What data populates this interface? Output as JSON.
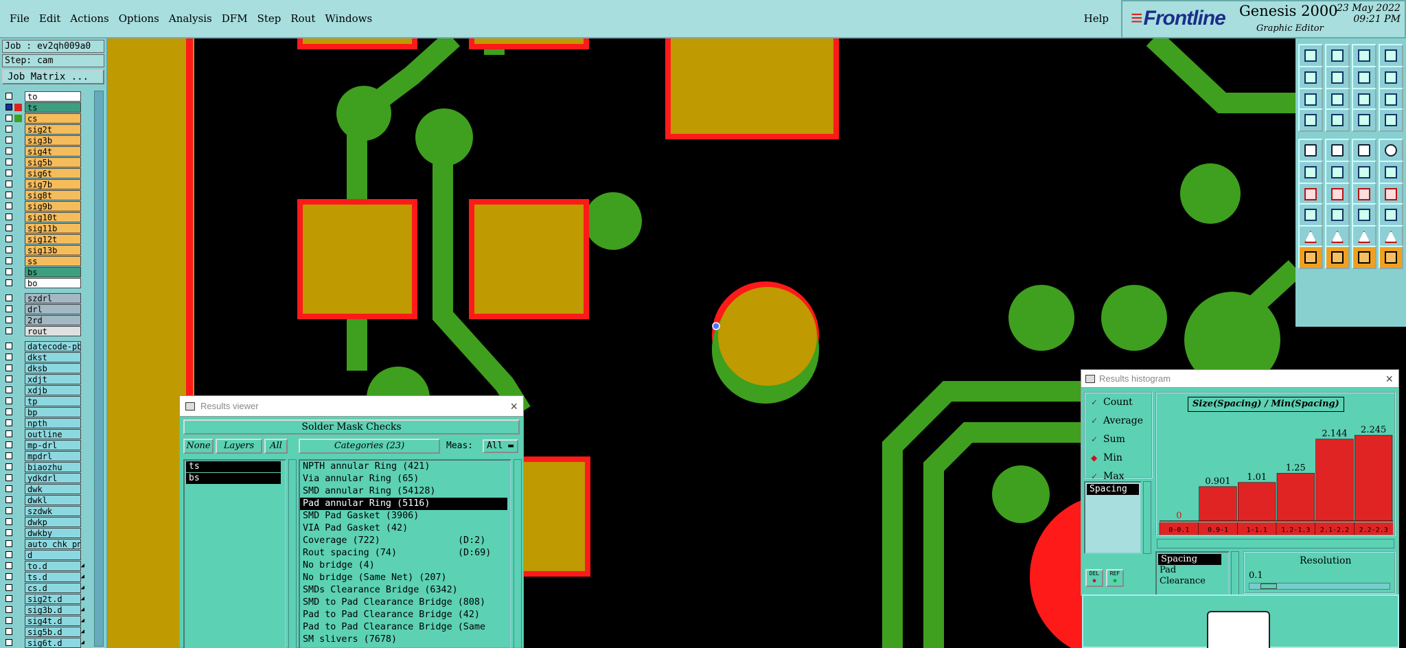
{
  "menu": [
    "File",
    "Edit",
    "Actions",
    "Options",
    "Analysis",
    "DFM",
    "Step",
    "Rout",
    "Windows"
  ],
  "help": "Help",
  "brand": {
    "logo": "Frontline",
    "product": "Genesis 2000",
    "subtitle": "Graphic Editor",
    "date": "23 May 2022",
    "time": "09:21 PM"
  },
  "job": {
    "job_line": "Job : ev2qh009a0",
    "step_line": "Step: cam",
    "matrix_button": "Job Matrix ..."
  },
  "layers": [
    {
      "name": "to",
      "bg": "#ffffff",
      "swatch": ""
    },
    {
      "name": "ts",
      "bg": "#3ca080",
      "swatch": "#e02020",
      "active": true
    },
    {
      "name": "cs",
      "bg": "#f5bc5c",
      "swatch": "#3f9f1f"
    },
    {
      "name": "sig2t",
      "bg": "#f5bc5c"
    },
    {
      "name": "sig3b",
      "bg": "#f5bc5c"
    },
    {
      "name": "sig4t",
      "bg": "#f5bc5c"
    },
    {
      "name": "sig5b",
      "bg": "#f5bc5c"
    },
    {
      "name": "sig6t",
      "bg": "#f5bc5c"
    },
    {
      "name": "sig7b",
      "bg": "#f5bc5c"
    },
    {
      "name": "sig8t",
      "bg": "#f5bc5c"
    },
    {
      "name": "sig9b",
      "bg": "#f5bc5c"
    },
    {
      "name": "sig10t",
      "bg": "#f5bc5c"
    },
    {
      "name": "sig11b",
      "bg": "#f5bc5c"
    },
    {
      "name": "sig12t",
      "bg": "#f5bc5c"
    },
    {
      "name": "sig13b",
      "bg": "#f5bc5c"
    },
    {
      "name": "ss",
      "bg": "#f5bc5c"
    },
    {
      "name": "bs",
      "bg": "#3ca080"
    },
    {
      "name": "bo",
      "bg": "#ffffff"
    },
    {
      "gap": true
    },
    {
      "name": "szdrl",
      "bg": "#a4b8c4"
    },
    {
      "name": "drl",
      "bg": "#a4b8c4"
    },
    {
      "name": "2rd",
      "bg": "#a4b8c4"
    },
    {
      "name": "rout",
      "bg": "#e0e0e0"
    },
    {
      "gap": true
    },
    {
      "name": "datecode-pbe",
      "bg": "#8cd8e0"
    },
    {
      "name": "dkst",
      "bg": "#8cd8e0"
    },
    {
      "name": "dksb",
      "bg": "#8cd8e0"
    },
    {
      "name": "xdjt",
      "bg": "#8cd8e0"
    },
    {
      "name": "xdjb",
      "bg": "#8cd8e0"
    },
    {
      "name": "tp",
      "bg": "#8cd8e0"
    },
    {
      "name": "bp",
      "bg": "#8cd8e0"
    },
    {
      "name": "npth",
      "bg": "#8cd8e0"
    },
    {
      "name": "outline",
      "bg": "#8cd8e0"
    },
    {
      "name": "mp-drl",
      "bg": "#8cd8e0"
    },
    {
      "name": "mpdrl",
      "bg": "#8cd8e0"
    },
    {
      "name": "biaozhu",
      "bg": "#8cd8e0"
    },
    {
      "name": "ydkdrl",
      "bg": "#8cd8e0"
    },
    {
      "name": "dwk",
      "bg": "#8cd8e0"
    },
    {
      "name": "dwkl",
      "bg": "#8cd8e0"
    },
    {
      "name": "szdwk",
      "bg": "#8cd8e0"
    },
    {
      "name": "dwkp",
      "bg": "#8cd8e0"
    },
    {
      "name": "dwkby",
      "bg": "#8cd8e0"
    },
    {
      "name": "auto_chk_pn",
      "bg": "#8cd8e0"
    },
    {
      "name": "d",
      "bg": "#8cd8e0"
    },
    {
      "name": "to.d",
      "bg": "#8cd8e0",
      "mark": "◢"
    },
    {
      "name": "ts.d",
      "bg": "#8cd8e0",
      "mark": "◢"
    },
    {
      "name": "cs.d",
      "bg": "#8cd8e0",
      "mark": "◢"
    },
    {
      "name": "sig2t.d",
      "bg": "#8cd8e0",
      "mark": "◢"
    },
    {
      "name": "sig3b.d",
      "bg": "#8cd8e0",
      "mark": "◢"
    },
    {
      "name": "sig4t.d",
      "bg": "#8cd8e0",
      "mark": "◢"
    },
    {
      "name": "sig5b.d",
      "bg": "#8cd8e0",
      "mark": "◢"
    },
    {
      "name": "sig6t.d",
      "bg": "#8cd8e0",
      "mark": "◢"
    }
  ],
  "viewer": {
    "title": "Results viewer",
    "check_name": "Solder Mask Checks",
    "none_btn": "None",
    "layers_btn": "Layers",
    "all_btn": "All",
    "categories_btn": "Categories (23)",
    "meas_label": "Meas:",
    "meas_value": "All",
    "selected_layers": [
      "ts",
      "bs"
    ],
    "categories": [
      {
        "label": "NPTH annular Ring (421)"
      },
      {
        "label": "Via annular Ring (65)"
      },
      {
        "label": "SMD annular Ring (54128)"
      },
      {
        "label": "Pad annular Ring (5116)",
        "selected": true
      },
      {
        "label": "SMD Pad Gasket (3906)"
      },
      {
        "label": "VIA Pad Gasket (42)"
      },
      {
        "label": "Coverage (722)",
        "d": "(D:2)"
      },
      {
        "label": "Rout spacing (74)",
        "d": "(D:69)"
      },
      {
        "label": "No bridge (4)"
      },
      {
        "label": "No bridge (Same Net) (207)"
      },
      {
        "label": "SMDs Clearance Bridge (6342)"
      },
      {
        "label": "SMD to Pad Clearance Bridge (808)"
      },
      {
        "label": "Pad to Pad Clearance Bridge (42)"
      },
      {
        "label": "Pad to Pad Clearance Bridge (Same"
      },
      {
        "label": "SM slivers (7678)"
      }
    ]
  },
  "histogram": {
    "title": "Results histogram",
    "stats": [
      {
        "label": "Count",
        "checked": false
      },
      {
        "label": "Average",
        "checked": false
      },
      {
        "label": "Sum",
        "checked": false
      },
      {
        "label": "Min",
        "checked": true
      },
      {
        "label": "Max",
        "checked": false
      }
    ],
    "spacing_item": "Spacing",
    "del_label": "DEL",
    "ref_label": "REF",
    "params": [
      {
        "label": "Spacing",
        "selected": true
      },
      {
        "label": "Pad"
      },
      {
        "label": "Clearance"
      }
    ],
    "resolution_title": "Resolution",
    "resolution_value": "0.1",
    "slider_fraction": 0.06
  },
  "chart_data": {
    "type": "bar",
    "title": "Size(Spacing) / Min(Spacing)",
    "categories": [
      "0-0.1",
      "0.9-1",
      "1-1.1",
      "1.2-1.3",
      "2.1-2.2",
      "2.2-2.3"
    ],
    "values": [
      0,
      0.901,
      1.01,
      1.25,
      2.144,
      2.245
    ],
    "value_labels": [
      "0",
      "0.901",
      "1.01",
      "1.25",
      "2.144",
      "2.245"
    ],
    "ylim": [
      0,
      2.3
    ]
  },
  "colors": {
    "accent_panel": "#88d0d0",
    "menubar": "#a8dede",
    "copper": "#3f9f1f",
    "mask_pad": "#bf9a00",
    "mask_opening": "#ff1a1a",
    "dialog": "#5cd1b4"
  }
}
